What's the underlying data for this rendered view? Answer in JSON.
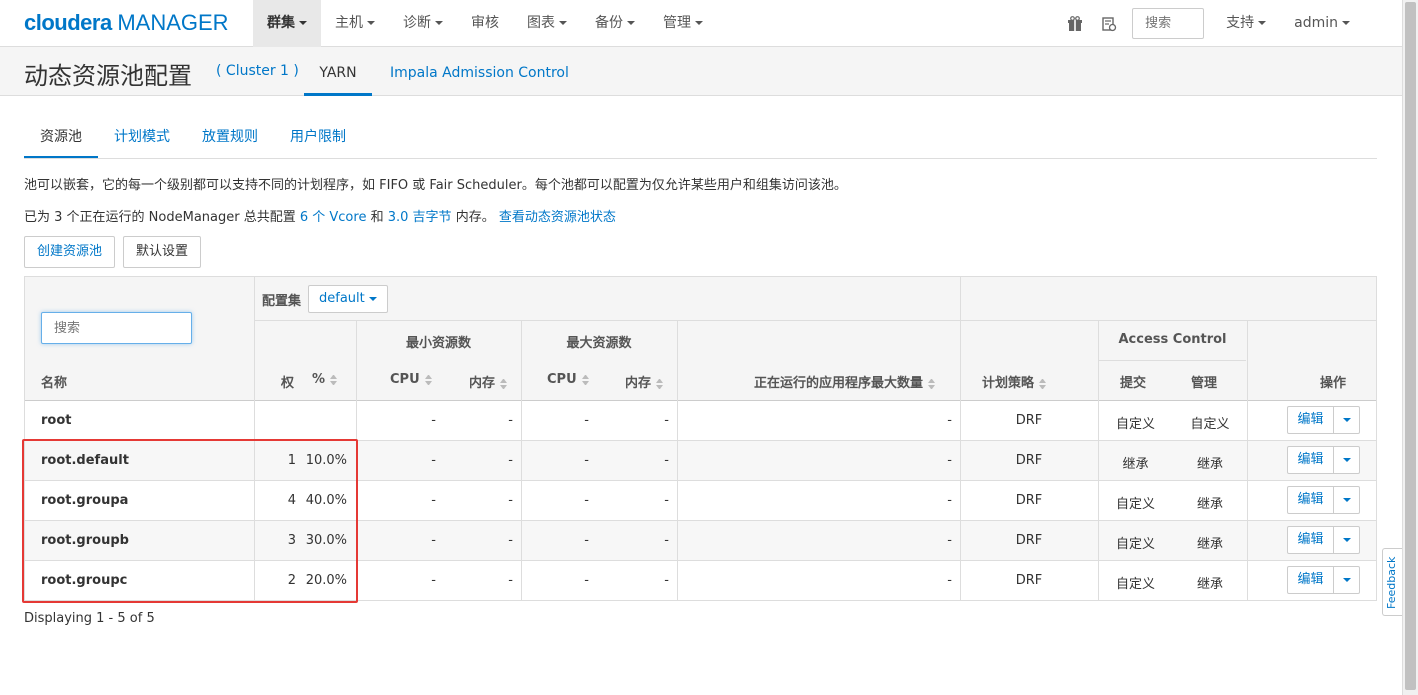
{
  "nav": {
    "logo_brand": "cloudera",
    "logo_product": "MANAGER",
    "menu": [
      "群集",
      "主机",
      "诊断",
      "审核",
      "图表",
      "备份",
      "管理"
    ],
    "search_placeholder": "搜索",
    "support": "支持",
    "user": "admin"
  },
  "subheader": {
    "title": "动态资源池配置",
    "cluster": "( Cluster 1 )",
    "tabs": [
      "YARN",
      "Impala Admission Control"
    ]
  },
  "tabs": [
    "资源池",
    "计划模式",
    "放置规则",
    "用户限制"
  ],
  "desc": {
    "line1": "池可以嵌套，它的每一个级别都可以支持不同的计划程序，如 FIFO 或 Fair Scheduler。每个池都可以配置为仅允许某些用户和组集访问该池。",
    "line2_prefix": "已为 3 个正在运行的 NodeManager 总共配置",
    "vcore_link": "6 个 Vcore",
    "and": "和",
    "memory_link": "3.0 吉字节",
    "line2_suffix": "内存。",
    "status_link": "查看动态资源池状态"
  },
  "buttons": {
    "create": "创建资源池",
    "defaults": "默认设置"
  },
  "table": {
    "search_placeholder": "搜索",
    "config_set_label": "配置集",
    "config_set_value": "default",
    "headers": {
      "name": "名称",
      "weight": "权",
      "percent": "%",
      "min_res": "最小资源数",
      "max_res": "最大资源数",
      "cpu": "CPU",
      "mem": "内存",
      "max_apps": "正在运行的应用程序最大数量",
      "policy": "计划策略",
      "access": "Access Control",
      "submit": "提交",
      "admin": "管理",
      "actions": "操作"
    },
    "rows": [
      {
        "name": "root",
        "weight": "",
        "pct": "",
        "min_cpu": "-",
        "min_mem": "-",
        "max_cpu": "-",
        "max_mem": "-",
        "max_apps": "-",
        "policy": "DRF",
        "submit": "自定义",
        "admin": "自定义"
      },
      {
        "name": "root.default",
        "weight": "1",
        "pct": "10.0%",
        "min_cpu": "-",
        "min_mem": "-",
        "max_cpu": "-",
        "max_mem": "-",
        "max_apps": "-",
        "policy": "DRF",
        "submit": "继承",
        "admin": "继承"
      },
      {
        "name": "root.groupa",
        "weight": "4",
        "pct": "40.0%",
        "min_cpu": "-",
        "min_mem": "-",
        "max_cpu": "-",
        "max_mem": "-",
        "max_apps": "-",
        "policy": "DRF",
        "submit": "自定义",
        "admin": "继承"
      },
      {
        "name": "root.groupb",
        "weight": "3",
        "pct": "30.0%",
        "min_cpu": "-",
        "min_mem": "-",
        "max_cpu": "-",
        "max_mem": "-",
        "max_apps": "-",
        "policy": "DRF",
        "submit": "自定义",
        "admin": "继承"
      },
      {
        "name": "root.groupc",
        "weight": "2",
        "pct": "20.0%",
        "min_cpu": "-",
        "min_mem": "-",
        "max_cpu": "-",
        "max_mem": "-",
        "max_apps": "-",
        "policy": "DRF",
        "submit": "自定义",
        "admin": "继承"
      }
    ],
    "edit_label": "编辑"
  },
  "footer": "Displaying 1 - 5 of 5",
  "feedback": "Feedback",
  "colors": {
    "link": "#0077c8",
    "highlight": "#e53935"
  }
}
